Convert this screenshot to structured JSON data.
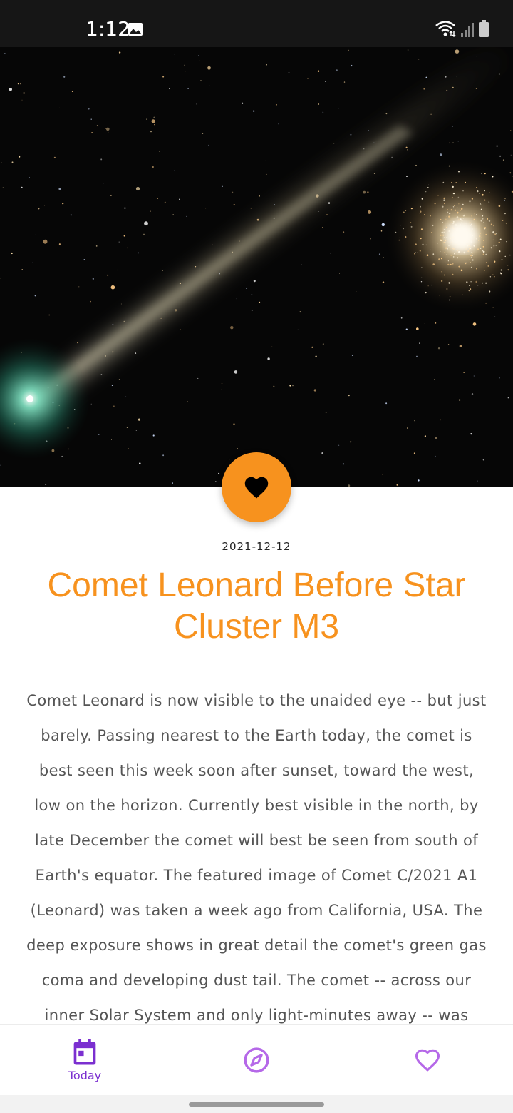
{
  "status_bar": {
    "time": "1:12",
    "icons": [
      "gallery-icon",
      "wifi-icon",
      "signal-icon",
      "battery-icon"
    ]
  },
  "hero": {
    "image_semantic": "comet-leonard-and-star-cluster-m3"
  },
  "fab": {
    "icon": "heart-icon",
    "color": "#f7921e"
  },
  "article": {
    "date": "2021-12-12",
    "title": "Comet Leonard Before Star Cluster M3",
    "explanation": "Comet Leonard is now visible to the unaided eye -- but just barely.  Passing nearest to the Earth today, the comet is best seen this week soon after sunset, toward the west, low on the horizon.  Currently best visible in the north, by late December the comet will best be seen from south of Earth's equator. The featured image of Comet C/2021 A1 (Leonard) was taken a week ago from California, USA. The deep exposure shows in great detail the comet's green gas coma and developing dust tail. The comet -- across our inner Solar System and only light-minutes away -- was captured passing"
  },
  "bottom_nav": {
    "items": [
      {
        "label": "Today",
        "icon": "calendar-icon",
        "active": true
      },
      {
        "label": "",
        "icon": "compass-icon",
        "active": false
      },
      {
        "label": "",
        "icon": "heart-outline-icon",
        "active": false
      }
    ],
    "accent_color": "#7b2fd0",
    "inactive_color": "#b568e8"
  }
}
